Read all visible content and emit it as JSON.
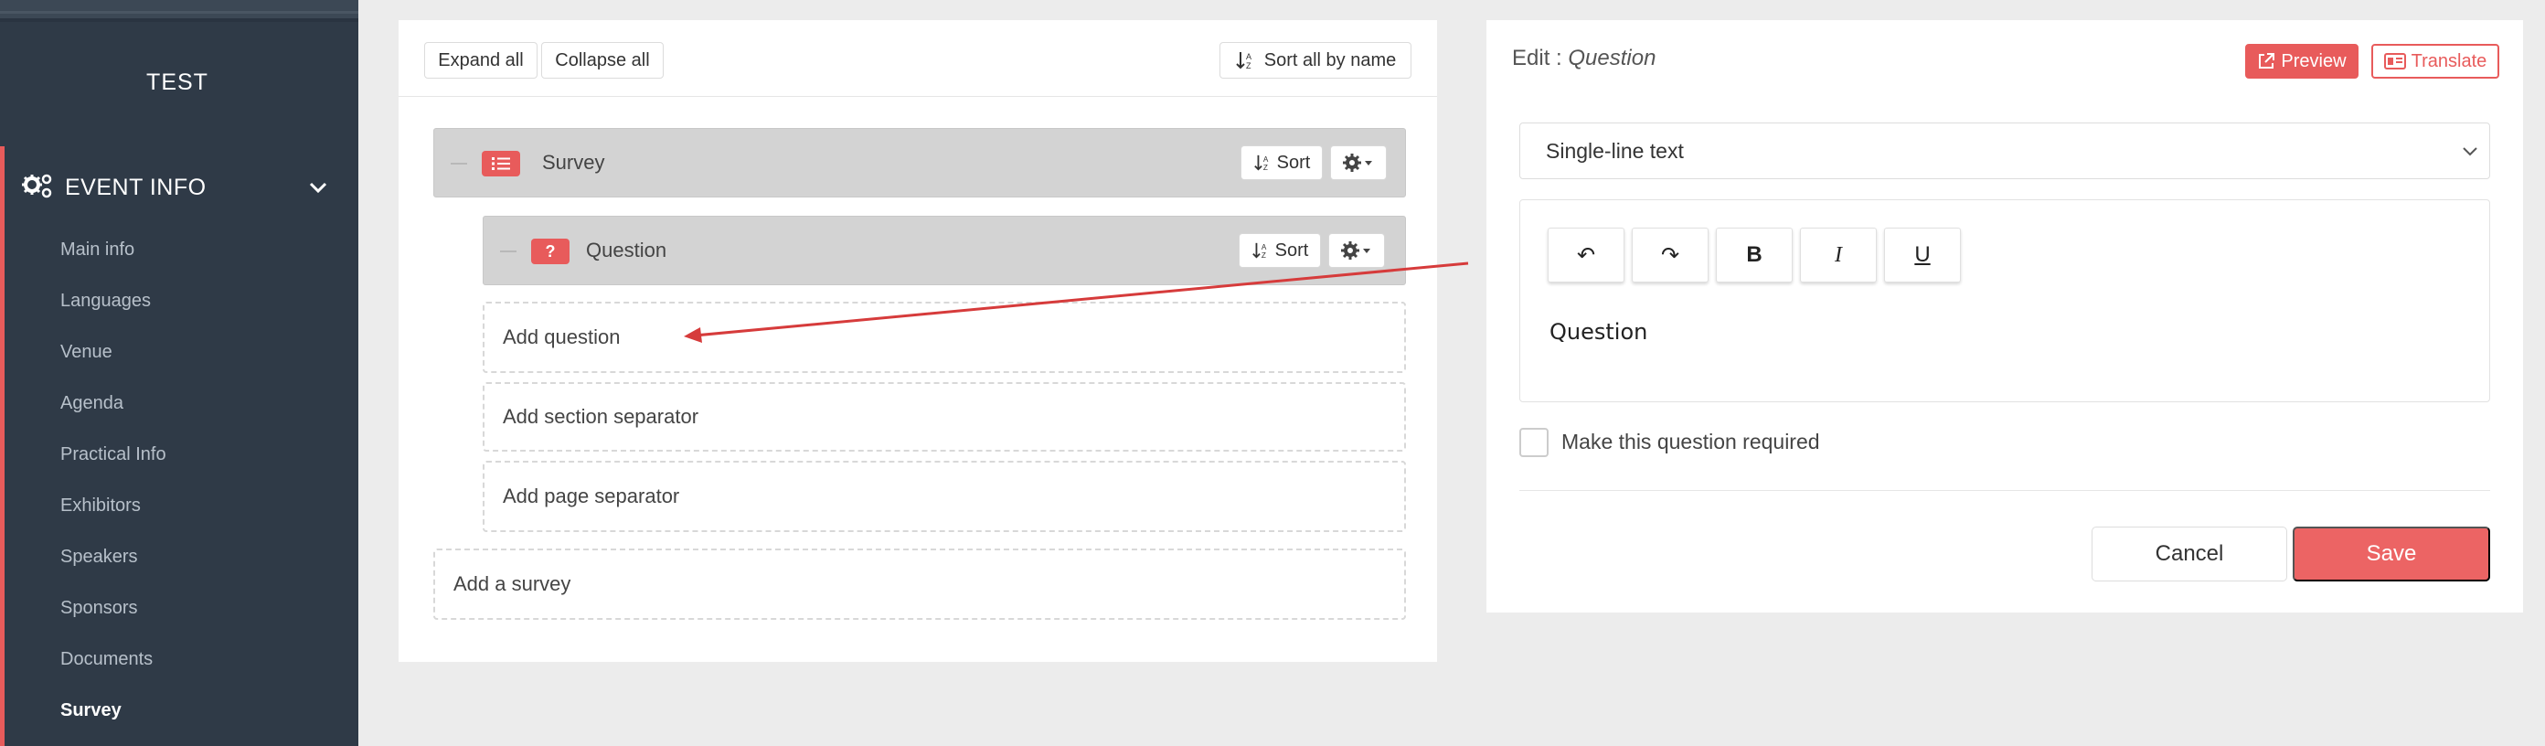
{
  "sidebar": {
    "title": "TEST",
    "section": {
      "label": "EVENT INFO",
      "icon": "gears-icon"
    },
    "items": [
      {
        "label": "Main info"
      },
      {
        "label": "Languages"
      },
      {
        "label": "Venue"
      },
      {
        "label": "Agenda"
      },
      {
        "label": "Practical Info"
      },
      {
        "label": "Exhibitors"
      },
      {
        "label": "Speakers"
      },
      {
        "label": "Sponsors"
      },
      {
        "label": "Documents"
      },
      {
        "label": "Survey",
        "active": true
      }
    ]
  },
  "toolbar": {
    "expand_all": "Expand all",
    "collapse_all": "Collapse all",
    "sort_all": "Sort all by name"
  },
  "tree": {
    "survey": {
      "title": "Survey",
      "sort_label": "Sort"
    },
    "question": {
      "title": "Question",
      "badge": "?",
      "sort_label": "Sort"
    },
    "add_question": "Add question",
    "add_section_separator": "Add section separator",
    "add_page_separator": "Add page separator",
    "add_survey": "Add a survey"
  },
  "editor": {
    "title_prefix": "Edit : ",
    "title_item": "Question",
    "preview_label": "Preview",
    "translate_label": "Translate",
    "type_value": "Single-line text",
    "format_buttons": {
      "undo": "↶",
      "redo": "↷",
      "bold": "B",
      "italic": "I",
      "underline": "U"
    },
    "content": "Question",
    "required_label": "Make this question required",
    "cancel_label": "Cancel",
    "save_label": "Save"
  },
  "colors": {
    "sidebar_bg": "#2f3a47",
    "accent": "#e85b5b",
    "save_bg": "#ec6464",
    "tree_row_bg": "#d3d3d3"
  }
}
